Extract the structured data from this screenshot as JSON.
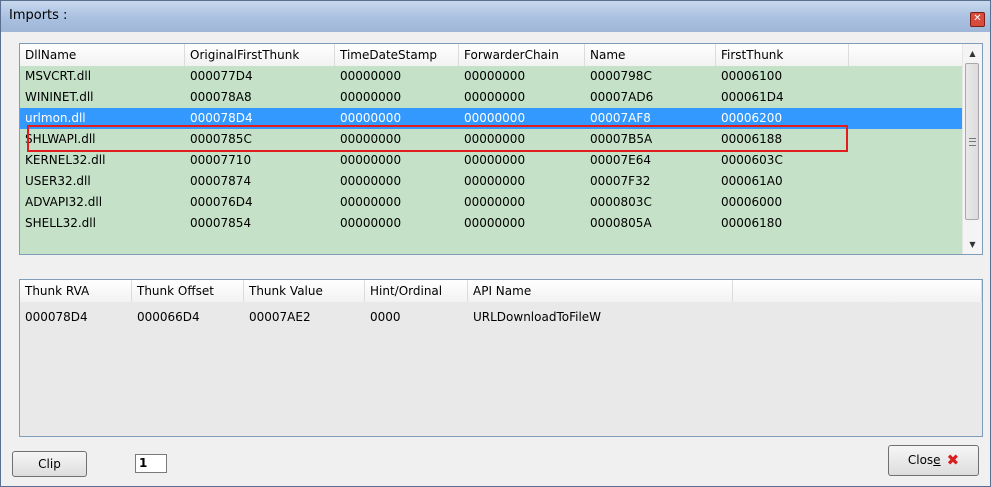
{
  "window": {
    "title": "Imports :"
  },
  "modules": {
    "columns": [
      "DllName",
      "OriginalFirstThunk",
      "TimeDateStamp",
      "ForwarderChain",
      "Name",
      "FirstThunk"
    ],
    "rows": [
      [
        "MSVCRT.dll",
        "000077D4",
        "00000000",
        "00000000",
        "0000798C",
        "00006100"
      ],
      [
        "WININET.dll",
        "000078A8",
        "00000000",
        "00000000",
        "00007AD6",
        "000061D4"
      ],
      [
        "urlmon.dll",
        "000078D4",
        "00000000",
        "00000000",
        "00007AF8",
        "00006200"
      ],
      [
        "SHLWAPI.dll",
        "0000785C",
        "00000000",
        "00000000",
        "00007B5A",
        "00006188"
      ],
      [
        "KERNEL32.dll",
        "00007710",
        "00000000",
        "00000000",
        "00007E64",
        "0000603C"
      ],
      [
        "USER32.dll",
        "00007874",
        "00000000",
        "00000000",
        "00007F32",
        "000061A0"
      ],
      [
        "ADVAPI32.dll",
        "000076D4",
        "00000000",
        "00000000",
        "0000803C",
        "00006000"
      ],
      [
        "SHELL32.dll",
        "00007854",
        "00000000",
        "00000000",
        "0000805A",
        "00006180"
      ]
    ],
    "selected_index": 2
  },
  "thunks": {
    "columns": [
      "Thunk RVA",
      "Thunk Offset",
      "Thunk Value",
      "Hint/Ordinal",
      "API Name"
    ],
    "rows": [
      [
        "000078D4",
        "000066D4",
        "00007AE2",
        "0000",
        "URLDownloadToFileW"
      ]
    ]
  },
  "footer": {
    "clip_label": "Clip",
    "count_value": "1",
    "close_label_pre": "Clos",
    "close_label_accel": "e"
  },
  "colors": {
    "row_bg": "#c5e1c7",
    "selected_bg": "#3399ff",
    "highlight_border": "#e11d1d",
    "close_icon": "#d81f1f"
  },
  "icons": {
    "window_close": "close-icon",
    "close_button": "red-x-icon",
    "scroll_up": "arrow-up-icon",
    "scroll_down": "arrow-down-icon"
  }
}
